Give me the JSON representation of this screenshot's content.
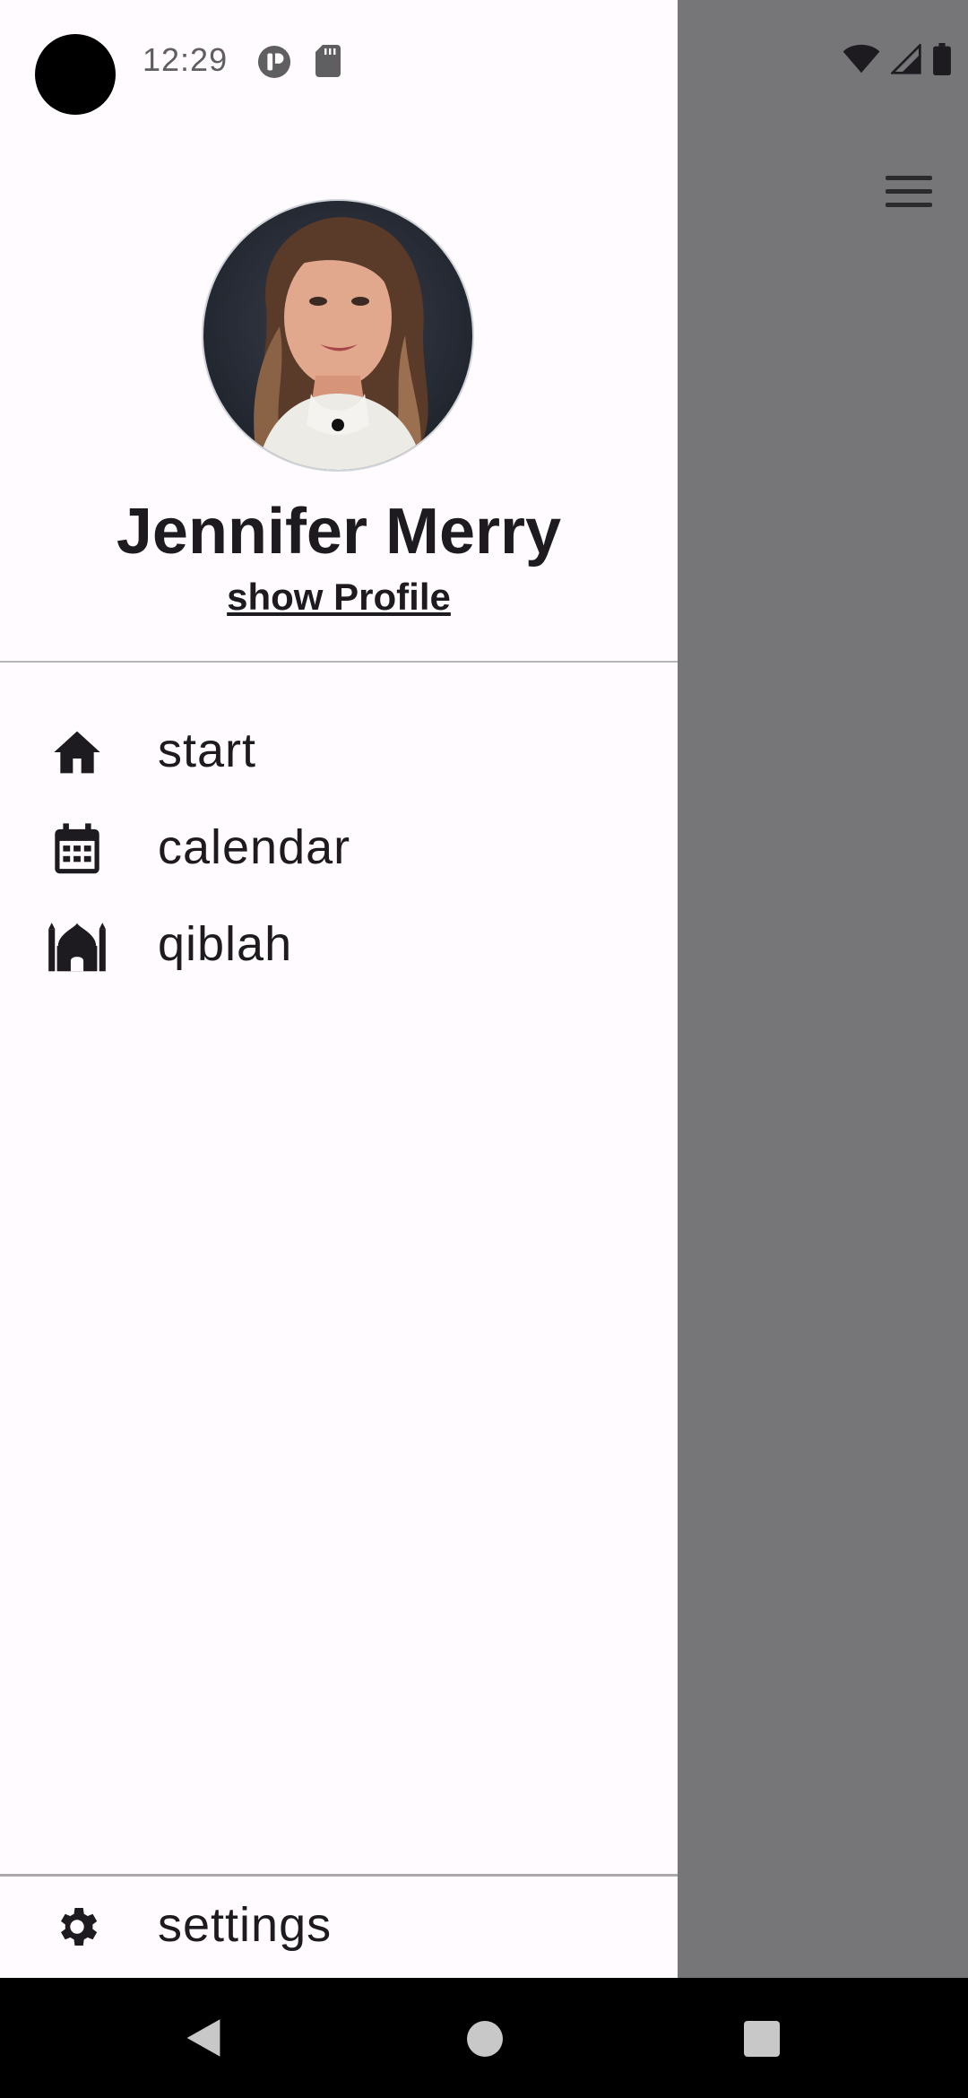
{
  "status_bar": {
    "time": "12:29"
  },
  "profile": {
    "name": "Jennifer Merry",
    "link_label": "show Profile"
  },
  "menu": {
    "items": [
      {
        "label": "start",
        "icon": "home-icon"
      },
      {
        "label": "calendar",
        "icon": "calendar-icon"
      },
      {
        "label": "qiblah",
        "icon": "mosque-icon"
      }
    ],
    "settings_label": "settings"
  },
  "colors": {
    "drawer_bg": "#fffbfe",
    "scrim": "#767578",
    "text": "#1d1b20"
  }
}
